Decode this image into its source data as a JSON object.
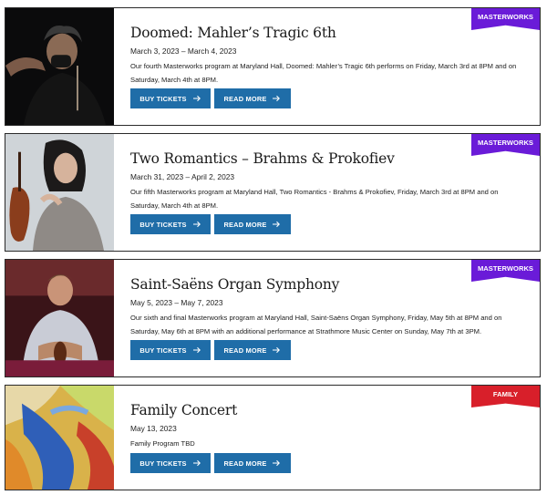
{
  "events": [
    {
      "title": "Doomed: Mahler’s Tragic 6th",
      "dates": "March 3, 2023 – March 4, 2023",
      "description": "Our fourth Masterworks program at Maryland Hall, Doomed: Mahler’s Tragic 6th performs on Friday, March 3rd at 8PM and on Saturday, March 4th at 8PM.",
      "badge": "MASTERWORKS",
      "badge_color": "#6a1bd8",
      "image": "conductor-photo",
      "buy_label": "BUY TICKETS",
      "read_label": "READ MORE"
    },
    {
      "title": "Two Romantics – Brahms & Prokofiev",
      "dates": "March 31, 2023 – April 2, 2023",
      "description": "Our fifth Masterworks program at Maryland Hall, Two Romantics - Brahms & Prokofiev, Friday, March 3rd at 8PM and on Saturday, March 4th at 8PM.",
      "badge": "MASTERWORKS",
      "badge_color": "#6a1bd8",
      "image": "violinist-photo",
      "buy_label": "BUY TICKETS",
      "read_label": "READ MORE"
    },
    {
      "title": "Saint-Saëns Organ Symphony",
      "dates": "May 5, 2023 – May 7, 2023",
      "description": "Our sixth and final Masterworks program at Maryland Hall, Saint-Saëns Organ Symphony, Friday, May 5th at 8PM and on Saturday, May 6th at 8PM with an additional performance at Strathmore Music Center on Sunday, May 7th at 3PM.",
      "badge": "MASTERWORKS",
      "badge_color": "#6a1bd8",
      "image": "soloist-photo",
      "buy_label": "BUY TICKETS",
      "read_label": "READ MORE"
    },
    {
      "title": "Family Concert",
      "dates": "May 13, 2023",
      "description": "Family Program TBD",
      "badge": "FAMILY",
      "badge_color": "#d81f2a",
      "image": "abstract-art",
      "buy_label": "BUY TICKETS",
      "read_label": "READ MORE"
    }
  ],
  "colors": {
    "button": "#1f6da8",
    "border": "#2a2a2a"
  }
}
